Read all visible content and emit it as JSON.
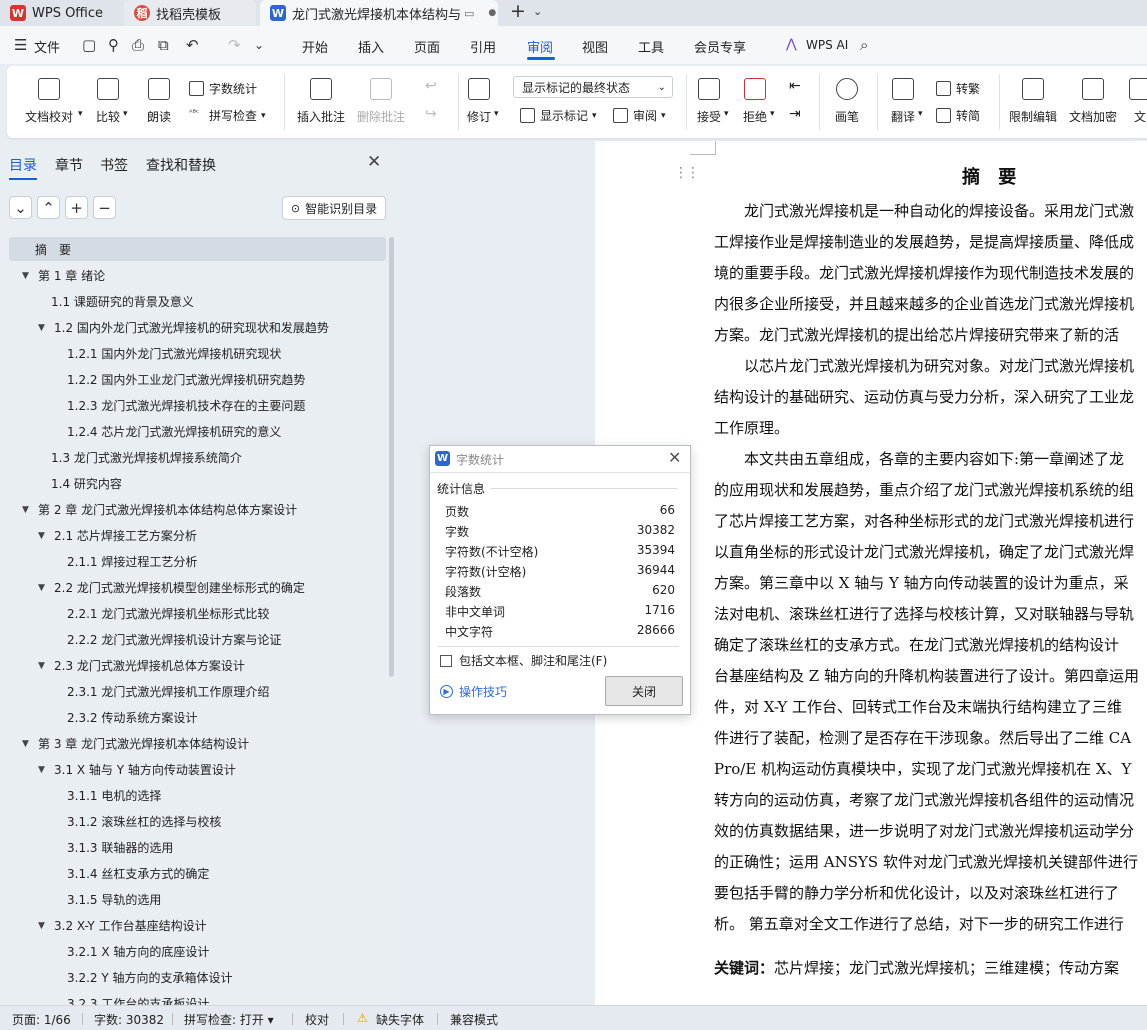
{
  "tabs": {
    "wps": "WPS Office",
    "template": "找稻壳模板",
    "doc": "龙门式激光焊接机本体结构与"
  },
  "menu": {
    "file": "文件",
    "items": [
      "开始",
      "插入",
      "页面",
      "引用",
      "审阅",
      "视图",
      "工具",
      "会员专享"
    ],
    "ai": "WPS AI"
  },
  "ribbon": {
    "proofread": "文档校对",
    "compare": "比较",
    "read_aloud": "朗读",
    "word_count": "字数统计",
    "spell_check": "拼写检查",
    "insert_comment": "插入批注",
    "delete_comment": "删除批注",
    "track": "修订",
    "markup_select": "显示标记的最终状态",
    "show_markup": "显示标记",
    "review": "审阅",
    "accept": "接受",
    "reject": "拒绝",
    "pen": "画笔",
    "translate": "翻译",
    "to_traditional": "转繁",
    "to_simplified": "转简",
    "restrict": "限制编辑",
    "encrypt": "文档加密",
    "doc_more": "文"
  },
  "nav": {
    "tabs": [
      "目录",
      "章节",
      "书签",
      "查找和替换"
    ],
    "smart": "智能识别目录",
    "toc": [
      {
        "text": "摘　要",
        "level": 0,
        "caret": ""
      },
      {
        "text": "第 1 章  绪论",
        "level": 0,
        "caret": "▼"
      },
      {
        "text": "1.1  课题研究的背景及意义",
        "level": 1,
        "caret": ""
      },
      {
        "text": "1.2  国内外龙门式激光焊接机的研究现状和发展趋势",
        "level": 1,
        "caret": "▼"
      },
      {
        "text": "1.2.1  国内外龙门式激光焊接机研究现状",
        "level": 2,
        "caret": ""
      },
      {
        "text": "1.2.2  国内外工业龙门式激光焊接机研究趋势",
        "level": 2,
        "caret": ""
      },
      {
        "text": "1.2.3  龙门式激光焊接机技术存在的主要问题",
        "level": 2,
        "caret": ""
      },
      {
        "text": "1.2.4  芯片龙门式激光焊接机研究的意义",
        "level": 2,
        "caret": ""
      },
      {
        "text": "1.3  龙门式激光焊接机焊接系统简介",
        "level": 1,
        "caret": ""
      },
      {
        "text": "1.4  研究内容",
        "level": 1,
        "caret": ""
      },
      {
        "text": "第 2 章  龙门式激光焊接机本体结构总体方案设计",
        "level": 0,
        "caret": "▼"
      },
      {
        "text": "2.1  芯片焊接工艺方案分析",
        "level": 1,
        "caret": "▼"
      },
      {
        "text": "2.1.1  焊接过程工艺分析",
        "level": 2,
        "caret": ""
      },
      {
        "text": "2.2  龙门式激光焊接机模型创建坐标形式的确定",
        "level": 1,
        "caret": "▼"
      },
      {
        "text": "2.2.1  龙门式激光焊接机坐标形式比较",
        "level": 2,
        "caret": ""
      },
      {
        "text": "2.2.2  龙门式激光焊接机设计方案与论证",
        "level": 2,
        "caret": ""
      },
      {
        "text": "2.3  龙门式激光焊接机总体方案设计",
        "level": 1,
        "caret": "▼"
      },
      {
        "text": "2.3.1 龙门式激光焊接机工作原理介绍",
        "level": 2,
        "caret": ""
      },
      {
        "text": "2.3.2  传动系统方案设计",
        "level": 2,
        "caret": ""
      },
      {
        "text": "第 3 章    龙门式激光焊接机本体结构设计",
        "level": 0,
        "caret": "▼"
      },
      {
        "text": "3.1 X 轴与 Y 轴方向传动装置设计",
        "level": 1,
        "caret": "▼"
      },
      {
        "text": "3.1.1  电机的选择",
        "level": 2,
        "caret": ""
      },
      {
        "text": "3.1.2 滚珠丝杠的选择与校核",
        "level": 2,
        "caret": ""
      },
      {
        "text": "3.1.3  联轴器的选用",
        "level": 2,
        "caret": ""
      },
      {
        "text": "3.1.4  丝杠支承方式的确定",
        "level": 2,
        "caret": ""
      },
      {
        "text": "3.1.5  导轨的选用",
        "level": 2,
        "caret": ""
      },
      {
        "text": "3.2    X-Y 工作台基座结构设计",
        "level": 1,
        "caret": "▼"
      },
      {
        "text": "3.2.1    X 轴方向的底座设计",
        "level": 2,
        "caret": ""
      },
      {
        "text": "3.2.2    Y 轴方向的支承箱体设计",
        "level": 2,
        "caret": ""
      },
      {
        "text": "3.2.3    工作台的支承板设计",
        "level": 2,
        "caret": ""
      }
    ]
  },
  "document": {
    "title": "摘  要",
    "lines": [
      "　　龙门式激光焊接机是一种自动化的焊接设备。采用龙门式激",
      "工焊接作业是焊接制造业的发展趋势，是提高焊接质量、降低成",
      "境的重要手段。龙门式激光焊接机焊接作为现代制造技术发展的",
      "内很多企业所接受，并且越来越多的企业首选龙门式激光焊接机",
      "方案。龙门式激光焊接机的提出给芯片焊接研究带来了新的活",
      "　　以芯片龙门式激光焊接机为研究对象。对龙门式激光焊接机",
      "结构设计的基础研究、运动仿真与受力分析，深入研究了工业龙",
      "工作原理。",
      "　　本文共由五章组成，各章的主要内容如下:第一章阐述了龙",
      "的应用现状和发展趋势，重点介绍了龙门式激光焊接机系统的组",
      "了芯片焊接工艺方案，对各种坐标形式的龙门式激光焊接机进行",
      "以直角坐标的形式设计龙门式激光焊接机，确定了龙门式激光焊",
      "方案。第三章中以 X 轴与 Y 轴方向传动装置的设计为重点，采",
      "法对电机、滚珠丝杠进行了选择与校核计算，又对联轴器与导轨",
      "确定了滚珠丝杠的支承方式。在龙门式激光焊接机的结构设计",
      "台基座结构及 Z 轴方向的升降机构装置进行了设计。第四章运用",
      "件，对 X-Y 工作台、回转式工作台及末端执行结构建立了三维",
      "件进行了装配，检测了是否存在干涉现象。然后导出了二维 CA",
      "Pro/E 机构运动仿真模块中，实现了龙门式激光焊接机在 X、Y",
      "转方向的运动仿真，考察了龙门式激光焊接机各组件的运动情况",
      "效的仿真数据结果，进一步说明了对龙门式激光焊接机运动学分",
      "的正确性；运用 ANSYS 软件对龙门式激光焊接机关键部件进行",
      "要包括手臂的静力学分析和优化设计，以及对滚珠丝杠进行了",
      "析。 第五章对全文工作进行了总结，对下一步的研究工作进行"
    ],
    "keywords_label": "关键词：",
    "keywords": "芯片焊接；龙门式激光焊接机；三维建模；传动方案"
  },
  "dialog": {
    "title": "字数统计",
    "section": "统计信息",
    "rows": [
      {
        "label": "页数",
        "value": "66"
      },
      {
        "label": "字数",
        "value": "30382"
      },
      {
        "label": "字符数(不计空格)",
        "value": "35394"
      },
      {
        "label": "字符数(计空格)",
        "value": "36944"
      },
      {
        "label": "段落数",
        "value": "620"
      },
      {
        "label": "非中文单词",
        "value": "1716"
      },
      {
        "label": "中文字符",
        "value": "28666"
      }
    ],
    "checkbox": "包括文本框、脚注和尾注(F)",
    "tips": "操作技巧",
    "close": "关闭"
  },
  "status": {
    "page": "页面: 1/66",
    "words": "字数: 30382",
    "spell": "拼写检查: 打开 ▾",
    "proof": "校对",
    "missing_font": "缺失字体",
    "compat": "兼容模式"
  },
  "colors": {
    "accent": "#1a5fd6",
    "wps_red": "#e0322c",
    "doc_blue": "#2b65d9"
  }
}
